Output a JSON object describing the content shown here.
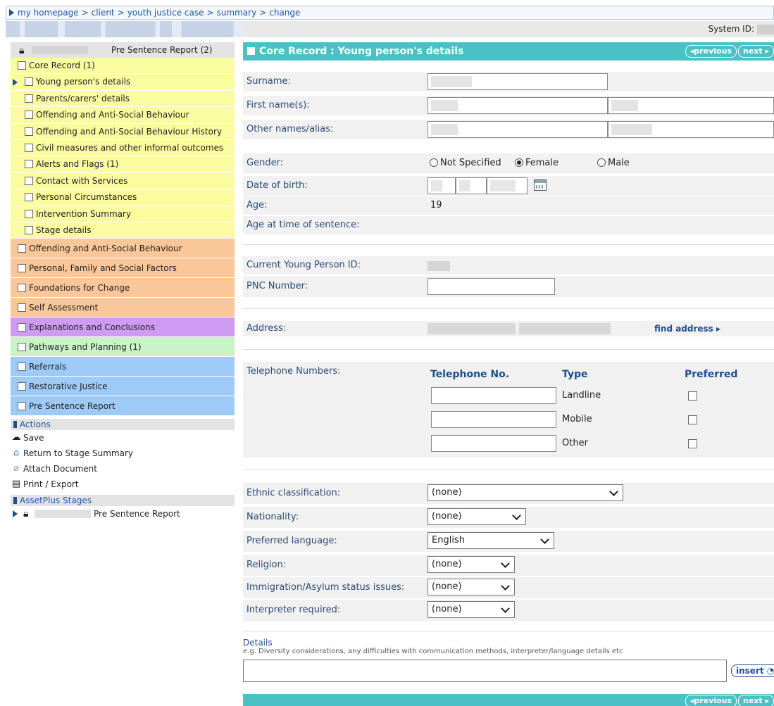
{
  "breadcrumb": [
    "my homepage",
    "client",
    "youth justice case",
    "summary",
    "change"
  ],
  "system_id_label": "System ID:",
  "nav": {
    "head_label": "Pre Sentence Report  (2)",
    "items": [
      {
        "label": "Core Record  (1)",
        "color": "yellow",
        "level": 0
      },
      {
        "label": "Young person's details",
        "color": "yellow",
        "level": 1,
        "current": true
      },
      {
        "label": "Parents/carers' details",
        "color": "yellow",
        "level": 1
      },
      {
        "label": "Offending and Anti-Social Behaviour",
        "color": "yellow",
        "level": 1
      },
      {
        "label": "Offending and Anti-Social Behaviour History",
        "color": "yellow",
        "level": 1
      },
      {
        "label": "Civil measures and other informal outcomes",
        "color": "yellow",
        "level": 1
      },
      {
        "label": "Alerts and Flags  (1)",
        "color": "yellow",
        "level": 1
      },
      {
        "label": "Contact with Services",
        "color": "yellow",
        "level": 1
      },
      {
        "label": "Personal Circumstances",
        "color": "yellow",
        "level": 1
      },
      {
        "label": "Intervention Summary",
        "color": "yellow",
        "level": 1
      },
      {
        "label": "Stage details",
        "color": "yellow",
        "level": 1
      },
      {
        "label": "Offending and Anti-Social Behaviour",
        "color": "orange",
        "level": 0,
        "big": true
      },
      {
        "label": "Personal, Family and Social Factors",
        "color": "orange",
        "level": 0,
        "big": true
      },
      {
        "label": "Foundations for Change",
        "color": "orange",
        "level": 0,
        "big": true
      },
      {
        "label": "Self Assessment",
        "color": "orange",
        "level": 0,
        "big": true
      },
      {
        "label": "Explanations and Conclusions",
        "color": "purple",
        "level": 0,
        "big": true
      },
      {
        "label": "Pathways and Planning  (1)",
        "color": "green",
        "level": 0,
        "big": true
      },
      {
        "label": "Referrals",
        "color": "blue",
        "level": 0,
        "big": true
      },
      {
        "label": "Restorative Justice",
        "color": "blue",
        "level": 0,
        "big": true
      },
      {
        "label": "Pre Sentence Report",
        "color": "blue",
        "level": 0,
        "big": true
      }
    ],
    "actions_title": "Actions",
    "actions": [
      {
        "label": "Save",
        "icon": "save-icon",
        "glyph": "☁"
      },
      {
        "label": "Return to Stage Summary",
        "icon": "home-icon",
        "glyph": "⌂"
      },
      {
        "label": "Attach Document",
        "icon": "paperclip-icon",
        "glyph": "⌀"
      },
      {
        "label": "Print / Export",
        "icon": "printer-icon",
        "glyph": "▤"
      }
    ],
    "stages_title": "AssetPlus Stages",
    "stage_label": "Pre Sentence Report"
  },
  "panel": {
    "title": "Core Record : Young person's details",
    "previous_label": "◂previous",
    "next_label": "next ▸",
    "surname_label": "Surname:",
    "firstname_label": "First name(s):",
    "othernames_label": "Other names/alias:",
    "gender_label": "Gender:",
    "gender_options": [
      "Not Specified",
      "Female",
      "Male"
    ],
    "gender_selected": "Female",
    "dob_label": "Date of birth:",
    "age_label": "Age:",
    "age_value": "19",
    "age_sentence_label": "Age at time of sentence:",
    "ypid_label": "Current Young Person ID:",
    "pnc_label": "PNC Number:",
    "address_label": "Address:",
    "find_address_label": "find address ▸",
    "telephone_label": "Telephone Numbers:",
    "tel_headers": {
      "number": "Telephone No.",
      "type": "Type",
      "preferred": "Preferred"
    },
    "tel_rows": [
      {
        "type": "Landline"
      },
      {
        "type": "Mobile"
      },
      {
        "type": "Other"
      }
    ],
    "ethnic_label": "Ethnic classification:",
    "ethnic_value": "(none)",
    "nationality_label": "Nationality:",
    "nationality_value": "(none)",
    "language_label": "Preferred language:",
    "language_value": "English",
    "religion_label": "Religion:",
    "religion_value": "(none)",
    "immigration_label": "Immigration/Asylum status issues:",
    "immigration_value": "(none)",
    "interpreter_label": "Interpreter required:",
    "interpreter_value": "(none)",
    "details_title": "Details",
    "details_hint": "e.g. Diversity considerations, any difficulties with communication methods, interpreter/language details etc",
    "insert_label": "insert ◔"
  }
}
